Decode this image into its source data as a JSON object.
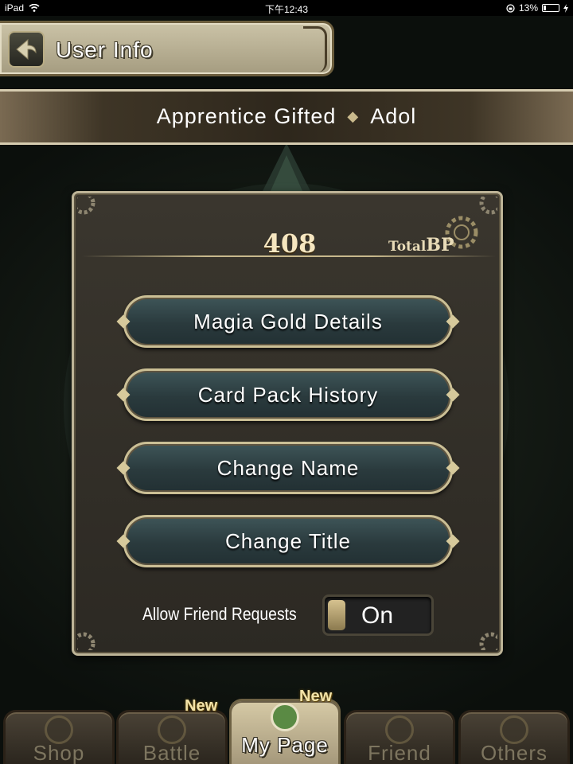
{
  "status_bar": {
    "device": "iPad",
    "time": "下午12:43",
    "battery": "13%"
  },
  "header": {
    "title": "User Info",
    "back_icon": "arrow-left-icon"
  },
  "profile": {
    "title": "Apprentice Gifted",
    "name": "Adol"
  },
  "battle_power": {
    "value": "408",
    "label_prefix": "Total",
    "label_suffix": "BP"
  },
  "menu": {
    "items": [
      {
        "label": "Magia Gold Details"
      },
      {
        "label": "Card Pack History"
      },
      {
        "label": "Change Name"
      },
      {
        "label": "Change Title"
      }
    ]
  },
  "friend_requests": {
    "label": "Allow Friend Requests",
    "value": "On"
  },
  "tabs": {
    "items": [
      {
        "label": "Shop",
        "icon": "coin-icon",
        "badge": ""
      },
      {
        "label": "Battle",
        "icon": "sword-icon",
        "badge": "New"
      },
      {
        "label": "My Page",
        "icon": "user-icon",
        "badge": "New",
        "active": true
      },
      {
        "label": "Friend",
        "icon": "friends-icon",
        "badge": ""
      },
      {
        "label": "Others",
        "icon": "help-icon",
        "badge": ""
      }
    ]
  },
  "colors": {
    "panel_border": "#bdb497",
    "button_fill": "#2a3a3d",
    "accent_gold": "#cbbf95"
  }
}
